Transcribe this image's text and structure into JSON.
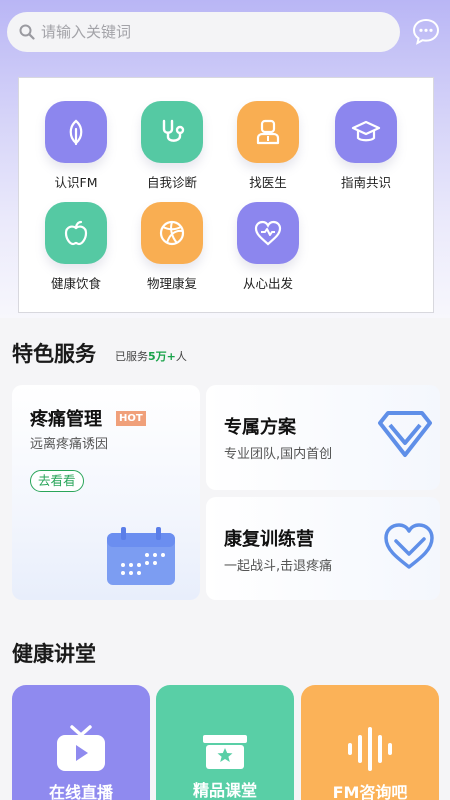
{
  "search": {
    "placeholder": "请输入关键词"
  },
  "menu": [
    {
      "label": "认识FM",
      "icon": "leaf-icon",
      "color": "#8c86ee"
    },
    {
      "label": "自我诊断",
      "icon": "stethoscope-icon",
      "color": "#55c9a3"
    },
    {
      "label": "找医生",
      "icon": "doctor-icon",
      "color": "#f9ae52"
    },
    {
      "label": "指南共识",
      "icon": "graduation-cap-icon",
      "color": "#8c86ee"
    },
    {
      "label": "健康饮食",
      "icon": "apple-icon",
      "color": "#55c9a3"
    },
    {
      "label": "物理康复",
      "icon": "ball-icon",
      "color": "#f9ae52"
    },
    {
      "label": "从心出发",
      "icon": "heart-icon",
      "color": "#8c86ee"
    }
  ],
  "featured": {
    "title": "特色服务",
    "served_prefix": "已服务",
    "served_count": "5万+",
    "served_suffix": "人",
    "pain": {
      "title": "疼痛管理",
      "badge": "HOT",
      "subtitle": "远离疼痛诱因",
      "button": "去看看",
      "icon": "calendar-icon"
    },
    "plan": {
      "title": "专属方案",
      "subtitle": "专业团队,国内首创",
      "icon": "diamond-icon"
    },
    "camp": {
      "title": "康复训练营",
      "subtitle": "一起战斗,击退疼痛",
      "icon": "heart-outline-icon"
    }
  },
  "lectures": {
    "title": "健康讲堂",
    "items": [
      {
        "label": "在线直播",
        "icon": "tv-icon",
        "color": "#8f8aef"
      },
      {
        "label": "精品课堂",
        "icon": "star-box-icon",
        "color": "#59cfa6"
      },
      {
        "label": "FM咨询吧",
        "icon": "voice-icon",
        "color": "#fbb258"
      }
    ]
  },
  "colors": {
    "accent_green": "#2aa55a",
    "hot": "#f0a07a",
    "purple": "#8c86ee"
  }
}
